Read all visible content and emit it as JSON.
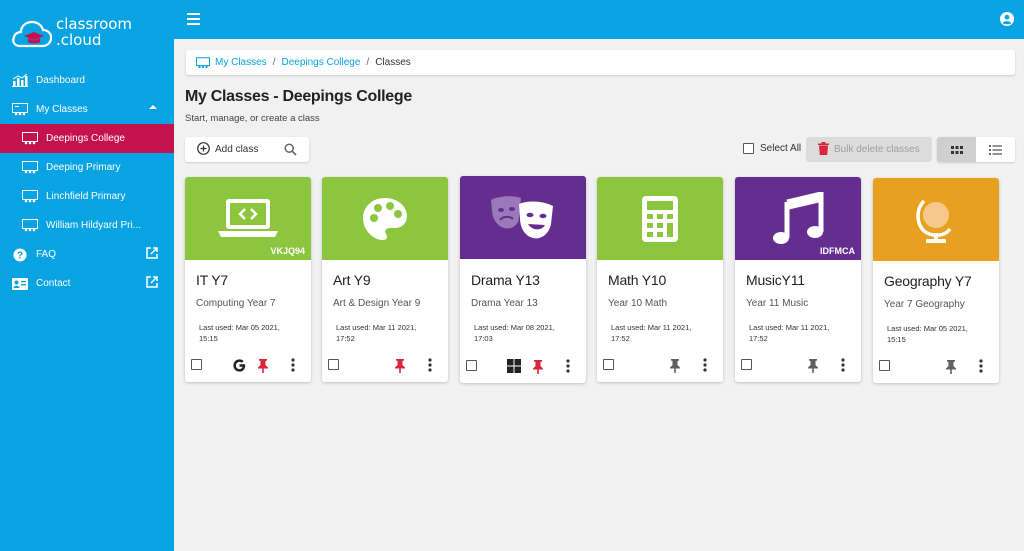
{
  "app": {
    "logo_line1": "classroom",
    "logo_line2": ".cloud"
  },
  "sidebar": {
    "items": [
      {
        "label": "Dashboard",
        "icon": "chart-bar-icon"
      },
      {
        "label": "My Classes",
        "icon": "classroom-icon"
      },
      {
        "label": "Deepings College",
        "icon": "classroom-icon",
        "active": true
      },
      {
        "label": "Deeping Primary",
        "icon": "classroom-icon"
      },
      {
        "label": "Linchfield Primary",
        "icon": "classroom-icon"
      },
      {
        "label": "William Hildyard Pri...",
        "icon": "classroom-icon"
      },
      {
        "label": "FAQ",
        "icon": "help-icon"
      },
      {
        "label": "Contact",
        "icon": "contact-card-icon"
      }
    ]
  },
  "breadcrumb": {
    "root": "My Classes",
    "school": "Deepings College",
    "current": "Classes"
  },
  "page": {
    "title": "My Classes - Deepings College",
    "subtitle": "Start, manage, or create a class"
  },
  "toolbar": {
    "add_label": "Add class",
    "select_all_label": "Select All",
    "bulk_delete_label": "Bulk delete classes"
  },
  "colors": {
    "primary": "#08a3e3",
    "active": "#c4124e",
    "green": "#8cc63f",
    "purple": "#662d91",
    "orange": "#e8a020",
    "pin_red": "#d9263d",
    "pin_grey": "#616161"
  },
  "classes": [
    {
      "title": "IT Y7",
      "subtitle": "Computing Year 7",
      "last_used_line1": "Last used: Mar 05 2021,",
      "last_used_line2": "15:15",
      "code": "VKJQ94",
      "color": "#8cc63f",
      "icon": "laptop-code-icon",
      "provider": "google-icon",
      "pinned": true
    },
    {
      "title": "Art Y9",
      "subtitle": "Art & Design Year 9",
      "last_used_line1": "Last used: Mar 11 2021,",
      "last_used_line2": "17:52",
      "code": "",
      "color": "#8cc63f",
      "icon": "palette-icon",
      "provider": "",
      "pinned": true
    },
    {
      "title": "Drama Y13",
      "subtitle": "Drama Year 13",
      "last_used_line1": "Last used: Mar 08 2021,",
      "last_used_line2": "17:03",
      "code": "",
      "color": "#662d91",
      "icon": "theater-masks-icon",
      "provider": "microsoft-icon",
      "pinned": true
    },
    {
      "title": "Math Y10",
      "subtitle": "Year 10 Math",
      "last_used_line1": "Last used: Mar 11 2021,",
      "last_used_line2": "17:52",
      "code": "",
      "color": "#8cc63f",
      "icon": "calculator-icon",
      "provider": "",
      "pinned": false
    },
    {
      "title": "MusicY11",
      "subtitle": "Year 11 Music",
      "last_used_line1": "Last used: Mar 11 2021,",
      "last_used_line2": "17:52",
      "code": "IDFMCA",
      "color": "#662d91",
      "icon": "music-note-icon",
      "provider": "",
      "pinned": false
    },
    {
      "title": "Geography Y7",
      "subtitle": "Year 7 Geography",
      "last_used_line1": "Last used: Mar 05 2021,",
      "last_used_line2": "15:15",
      "code": "",
      "color": "#e8a020",
      "icon": "globe-icon",
      "provider": "",
      "pinned": false
    }
  ]
}
